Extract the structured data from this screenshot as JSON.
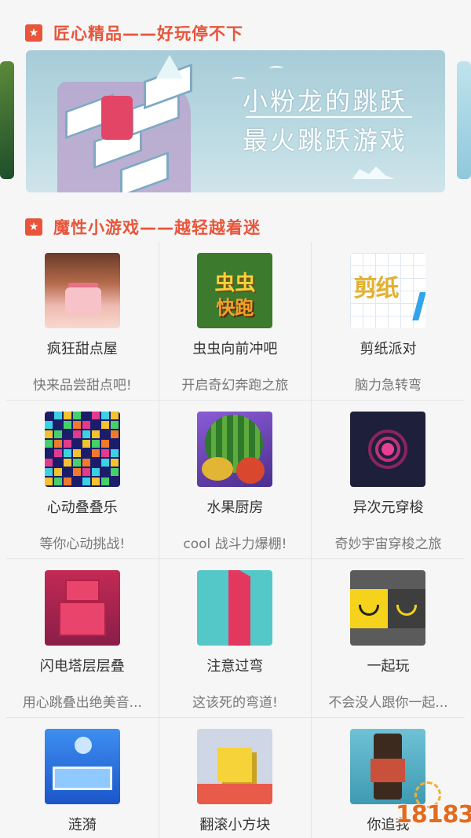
{
  "section1": {
    "icon": "star-icon",
    "title": "匠心精品——好玩停不下"
  },
  "banner": {
    "line1": "小粉龙的跳跃",
    "line2": "最火跳跃游戏"
  },
  "section2": {
    "icon": "star-icon",
    "title": "魔性小游戏——越轻越着迷"
  },
  "games": [
    {
      "name": "疯狂甜点屋",
      "desc": "快来品尝甜点吧!"
    },
    {
      "name": "虫虫向前冲吧",
      "desc": "开启奇幻奔跑之旅",
      "icon_text": [
        "虫虫",
        "快跑"
      ]
    },
    {
      "name": "剪纸派对",
      "desc": "脑力急转弯",
      "icon_text": "剪纸"
    },
    {
      "name": "心动叠叠乐",
      "desc": "等你心动挑战!"
    },
    {
      "name": "水果厨房",
      "desc": "cool 战斗力爆棚!"
    },
    {
      "name": "异次元穿梭",
      "desc": "奇妙宇宙穿梭之旅"
    },
    {
      "name": "闪电塔层层叠",
      "desc": "用心跳叠出绝美音..."
    },
    {
      "name": "注意过弯",
      "desc": "这该死的弯道!"
    },
    {
      "name": "一起玩",
      "desc": "不会没人跟你一起..."
    },
    {
      "name": "涟漪",
      "desc": ""
    },
    {
      "name": "翻滚小方块",
      "desc": ""
    },
    {
      "name": "你追我",
      "desc": ""
    }
  ],
  "watermark": "18183",
  "colors": {
    "accent": "#e8553a",
    "background": "#f6f6f6"
  }
}
